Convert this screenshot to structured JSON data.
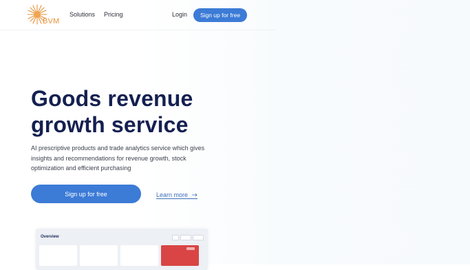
{
  "brand": {
    "name": "BVM",
    "accent": "#e8913a"
  },
  "nav": {
    "solutions": "Solutions",
    "pricing": "Pricing",
    "login": "Login",
    "signup": "Sign up for free"
  },
  "hero": {
    "title_line1": "Goods revenue",
    "title_line2": "growth service",
    "description": "AI prescriptive products and trade analytics service which gives insights and recommendations for revenue growth, stock optimization and efficient purchasing",
    "cta": "Sign up for free",
    "learn_more": "Learn more",
    "learn_more_icon": "arrow-right-icon"
  },
  "preview": {
    "title": "Overview"
  },
  "colors": {
    "primary": "#3c7bd6",
    "heading": "#152050",
    "alert": "#d94545"
  }
}
